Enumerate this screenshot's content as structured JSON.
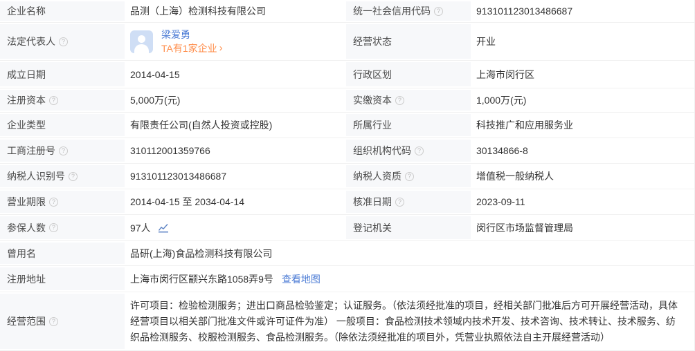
{
  "colors": {
    "link_blue": "#4b7bd5",
    "highlight_orange": "#ff8f4d",
    "label_bg": "#f7f8fa",
    "row_border": "#f1f1f1",
    "avatar_bg": "#cfdef5"
  },
  "icons": {
    "help": "?",
    "chevron_right": "›"
  },
  "fields": {
    "company_name": {
      "label": "企业名称",
      "value": "品测（上海）检测科技有限公司"
    },
    "credit_code": {
      "label": "统一社会信用代码",
      "value": "913101123013486687"
    },
    "legal_rep": {
      "label": "法定代表人",
      "name": "梁爱勇",
      "companies_link": "TA有1家企业"
    },
    "status": {
      "label": "经营状态",
      "value": "开业"
    },
    "est_date": {
      "label": "成立日期",
      "value": "2014-04-15"
    },
    "admin_division": {
      "label": "行政区划",
      "value": "上海市闵行区"
    },
    "reg_capital": {
      "label": "注册资本",
      "value": "5,000万(元)"
    },
    "paid_capital": {
      "label": "实缴资本",
      "value": "1,000万(元)"
    },
    "company_type": {
      "label": "企业类型",
      "value": "有限责任公司(自然人投资或控股)"
    },
    "industry": {
      "label": "所属行业",
      "value": "科技推广和应用服务业"
    },
    "reg_number": {
      "label": "工商注册号",
      "value": "310112001359766"
    },
    "org_code": {
      "label": "组织机构代码",
      "value": "30134866-8"
    },
    "taxpayer_id": {
      "label": "纳税人识别号",
      "value": "913101123013486687"
    },
    "taxpayer_quality": {
      "label": "纳税人资质",
      "value": "增值税一般纳税人"
    },
    "business_term": {
      "label": "营业期限",
      "value": "2014-04-15 至 2034-04-14"
    },
    "approval_date": {
      "label": "核准日期",
      "value": "2023-09-11"
    },
    "insured_count": {
      "label": "参保人数",
      "value": "97人"
    },
    "reg_authority": {
      "label": "登记机关",
      "value": "闵行区市场监督管理局"
    },
    "former_name": {
      "label": "曾用名",
      "value": "品研(上海)食品检测科技有限公司"
    },
    "reg_address": {
      "label": "注册地址",
      "value": "上海市闵行区颛兴东路1058弄9号",
      "map_link": "查看地图"
    },
    "business_scope": {
      "label": "经营范围",
      "value": "许可项目：检验检测服务；进出口商品检验鉴定；认证服务。（依法须经批准的项目，经相关部门批准后方可开展经营活动，具体经营项目以相关部门批准文件或许可证件为准） 一般项目：食品检测技术领域内技术开发、技术咨询、技术转让、技术服务、纺织品检测服务、校服检测服务、食品检测服务。（除依法须经批准的项目外，凭营业执照依法自主开展经营活动）"
    }
  }
}
